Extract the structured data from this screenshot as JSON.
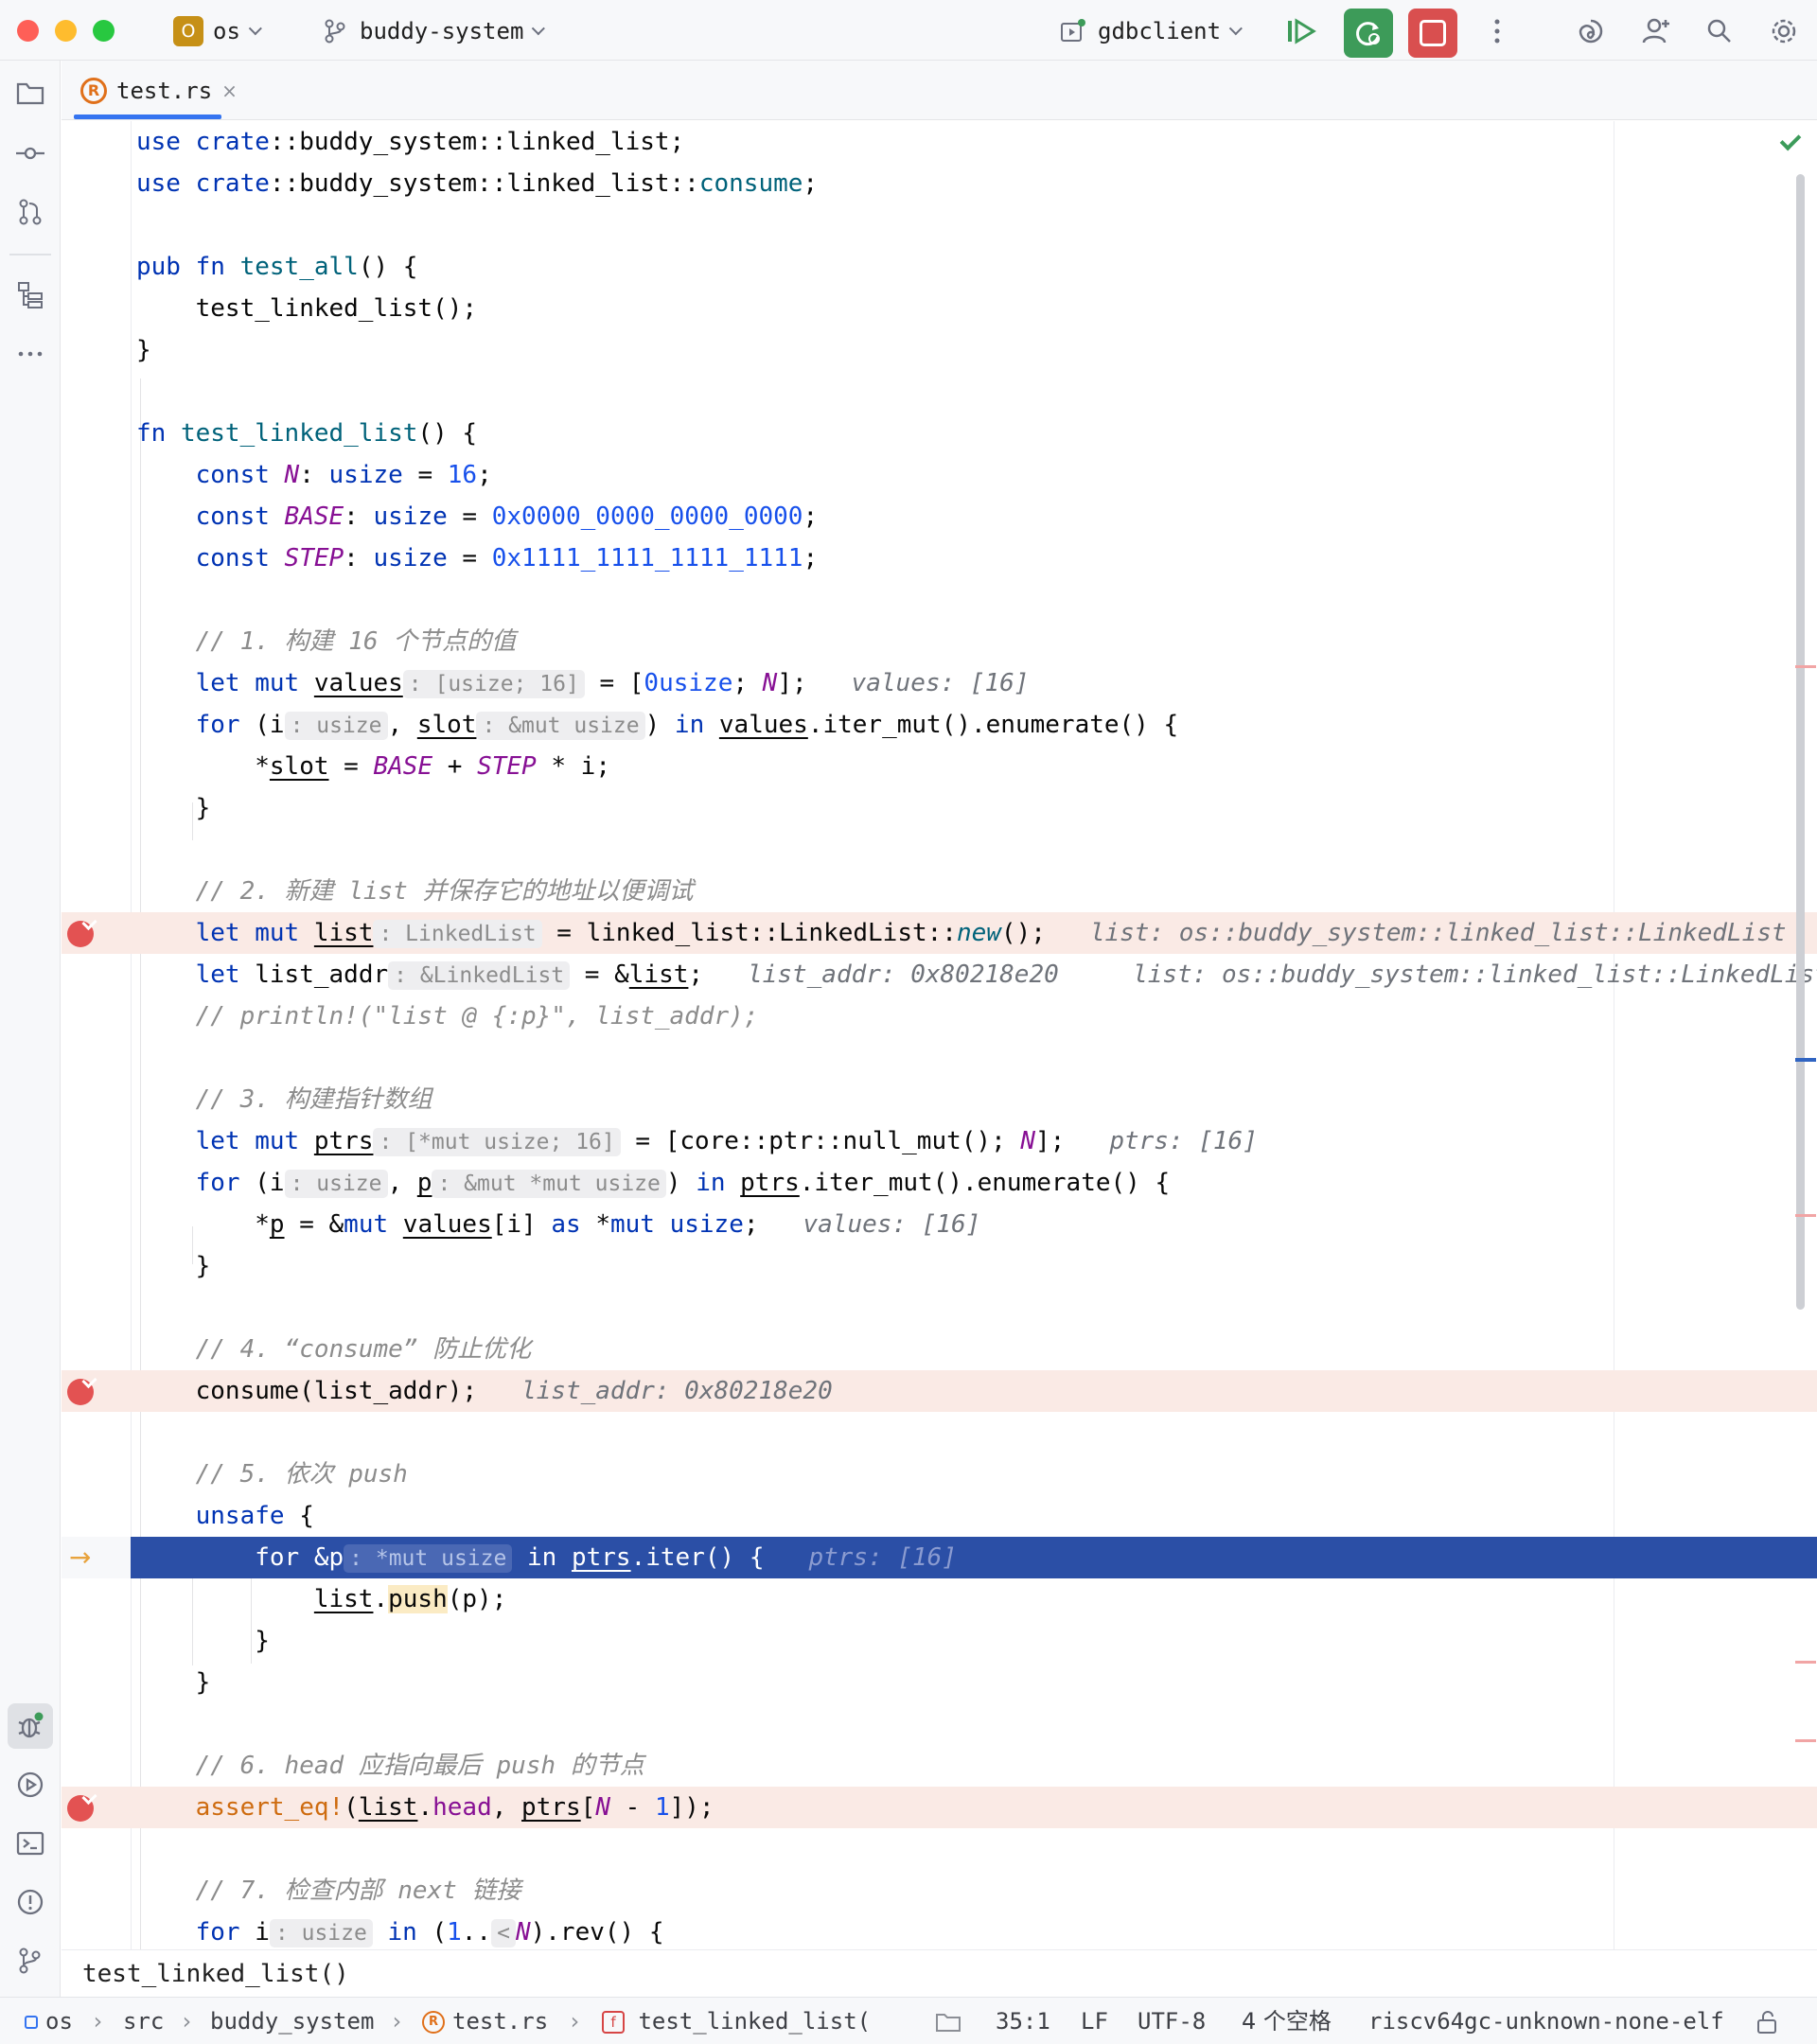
{
  "titlebar": {
    "project_badge": "O",
    "project_name": "os",
    "branch_name": "buddy-system",
    "run_config": "gdbclient"
  },
  "tab": {
    "label": "test.rs",
    "close": "×"
  },
  "editor": {
    "lines": {
      "l1": "use crate::buddy_system::linked_list;",
      "l2a": "use crate::buddy_system::linked_list::",
      "l2b": "consume",
      "l4": "pub fn test_all() {",
      "l5": "test_linked_list();",
      "l6": "}",
      "l8": "fn test_linked_list() {",
      "l9_name": "N",
      "l9_val": "16",
      "l10_name": "BASE",
      "l10_val": "0x0000_0000_0000_0000",
      "l11_name": "STEP",
      "l11_val": "0x1111_1111_1111_1111",
      "c1": "// 1. 构建 16 个节点的值",
      "l14_var": "values",
      "l14_hint": ": [usize; 16]",
      "l14_rest": "0usize",
      "l14_ival": "values: [16]",
      "l15_h1": ": usize",
      "l15_var": "slot",
      "l15_h2": ": &mut usize",
      "c2": "// 2. 新建 list 并保存它的地址以便调试",
      "l20_var": "list",
      "l20_hint": ": LinkedList",
      "l20_call": "new",
      "l20_ival": "list: os::buddy_system::linked_list::LinkedList",
      "l21_hint": ": &LinkedList",
      "l21_ival1": "list_addr: 0x80218e20",
      "l21_ival2": "list: os::buddy_system::linked_list::LinkedList",
      "l22": "// println!(\"list @ {:p}\", list_addr);",
      "c3": "// 3. 构建指针数组",
      "l25_hint": ": [*mut usize; 16]",
      "l25_ival": "ptrs: [16]",
      "l26_h1": ": usize",
      "l26_h2": ": &mut *mut usize",
      "l27_ival": "values: [16]",
      "c4": "// 4. “consume” 防止优化",
      "l31_ival": "list_addr: 0x80218e20",
      "c5": "// 5. 依次 push",
      "l35_hint": ": *mut usize",
      "l35_ival": "ptrs: [16]",
      "c6": "// 6. head 应指向最后 push 的节点",
      "l41_macro": "assert_eq!",
      "c7": "// 7. 检查内部 next 链接",
      "l44_hint": ": usize",
      "l44_hint2": "<"
    }
  },
  "function_crumb": "test_linked_list()",
  "statusbar": {
    "path": [
      "os",
      "src",
      "buddy_system",
      "test.rs",
      "test_linked_list("
    ],
    "position": "35:1",
    "line_sep": "LF",
    "encoding": "UTF-8",
    "indent": "4 个空格",
    "target": "riscv64gc-unknown-none-elf"
  },
  "colors": {
    "keyword": "#0033b3",
    "breakpoint": "#e35252",
    "exec_line": "#2b4fa6",
    "run_green": "#3d9b59",
    "stop_red": "#d94f4f"
  }
}
